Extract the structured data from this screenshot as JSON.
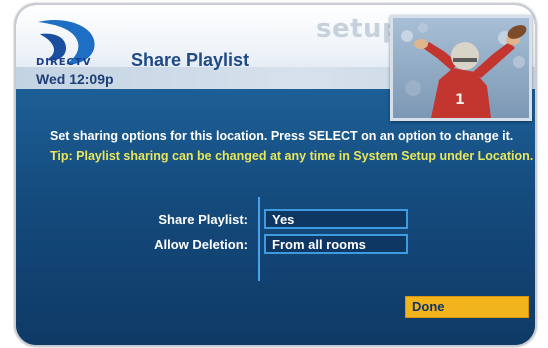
{
  "header": {
    "brand": "DIRECTV",
    "section": "setup",
    "title": "Share Playlist",
    "clock": "Wed 12:09p"
  },
  "instructions": {
    "message": "Set sharing options for this location. Press SELECT on an option to change it.",
    "tip": "Tip: Playlist sharing can be changed at any time in System Setup under Location."
  },
  "options": [
    {
      "label": "Share Playlist:",
      "value": "Yes"
    },
    {
      "label": "Allow Deletion:",
      "value": "From all rooms"
    }
  ],
  "actions": {
    "done_label": "Done"
  },
  "colors": {
    "accent": "#f2b41c",
    "tip_text": "#e8e65a",
    "field_border": "#3f9be0",
    "panel_blue": "#144a7c"
  },
  "icons": {
    "logo": "directv-logo",
    "photo": "football-player-photo"
  }
}
